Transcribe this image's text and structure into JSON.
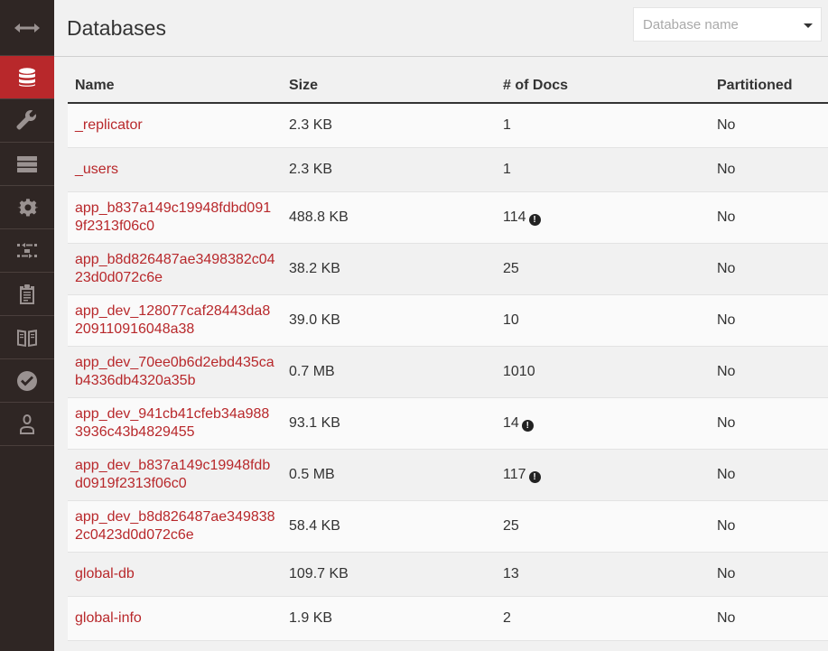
{
  "header": {
    "title": "Databases",
    "search_placeholder": "Database name"
  },
  "sidebar": {
    "items": [
      {
        "icon": "expand-arrows-icon"
      },
      {
        "icon": "database-icon",
        "active": true
      },
      {
        "icon": "wrench-icon"
      },
      {
        "icon": "server-list-icon"
      },
      {
        "icon": "gear-icon"
      },
      {
        "icon": "replication-icon"
      },
      {
        "icon": "clipboard-icon"
      },
      {
        "icon": "book-icon"
      },
      {
        "icon": "check-circle-icon"
      },
      {
        "icon": "user-icon"
      }
    ]
  },
  "table": {
    "columns": [
      "Name",
      "Size",
      "# of Docs",
      "Partitioned"
    ],
    "rows": [
      {
        "name": "_replicator",
        "size": "2.3 KB",
        "docs": "1",
        "warn": false,
        "partitioned": "No"
      },
      {
        "name": "_users",
        "size": "2.3 KB",
        "docs": "1",
        "warn": false,
        "partitioned": "No"
      },
      {
        "name": "app_b837a149c19948fdbd0919f2313f06c0",
        "size": "488.8 KB",
        "docs": "114",
        "warn": true,
        "partitioned": "No"
      },
      {
        "name": "app_b8d826487ae3498382c0423d0d072c6e",
        "size": "38.2 KB",
        "docs": "25",
        "warn": false,
        "partitioned": "No"
      },
      {
        "name": "app_dev_128077caf28443da8209110916048a38",
        "size": "39.0 KB",
        "docs": "10",
        "warn": false,
        "partitioned": "No"
      },
      {
        "name": "app_dev_70ee0b6d2ebd435cab4336db4320a35b",
        "size": "0.7 MB",
        "docs": "1010",
        "warn": false,
        "partitioned": "No"
      },
      {
        "name": "app_dev_941cb41cfeb34a9883936c43b4829455",
        "size": "93.1 KB",
        "docs": "14",
        "warn": true,
        "partitioned": "No"
      },
      {
        "name": "app_dev_b837a149c19948fdbd0919f2313f06c0",
        "size": "0.5 MB",
        "docs": "117",
        "warn": true,
        "partitioned": "No"
      },
      {
        "name": "app_dev_b8d826487ae3498382c0423d0d072c6e",
        "size": "58.4 KB",
        "docs": "25",
        "warn": false,
        "partitioned": "No"
      },
      {
        "name": "global-db",
        "size": "109.7 KB",
        "docs": "13",
        "warn": false,
        "partitioned": "No"
      },
      {
        "name": "global-info",
        "size": "1.9 KB",
        "docs": "2",
        "warn": false,
        "partitioned": "No"
      }
    ]
  }
}
